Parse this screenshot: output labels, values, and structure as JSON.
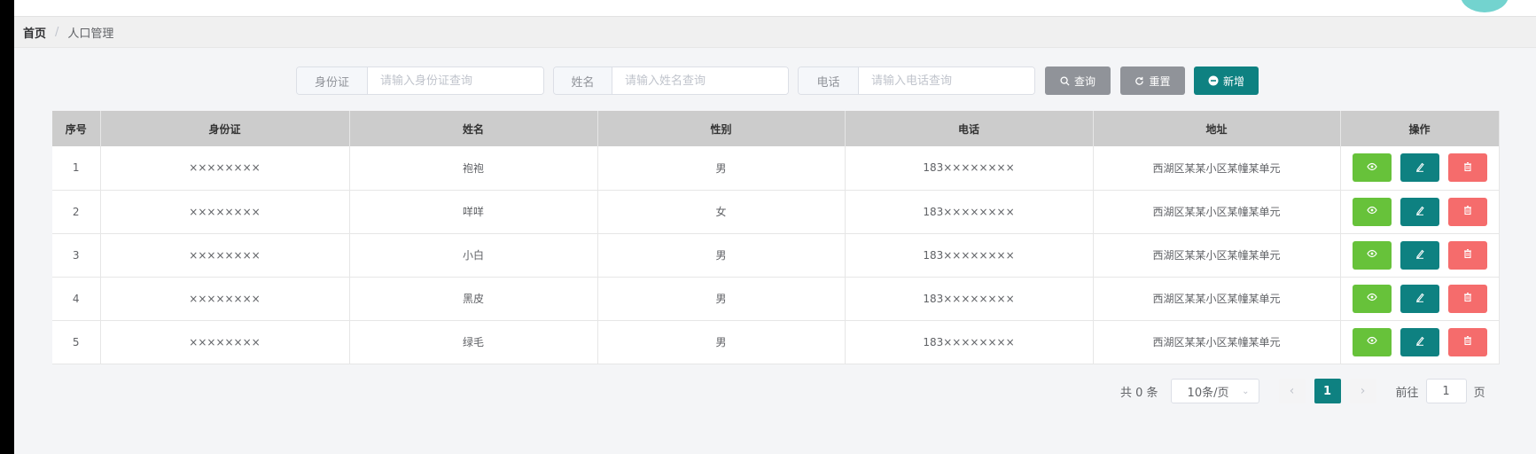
{
  "breadcrumb": {
    "home": "首页",
    "separator": "/",
    "current": "人口管理"
  },
  "search": {
    "id_label": "身份证",
    "id_placeholder": "请输入身份证查询",
    "name_label": "姓名",
    "name_placeholder": "请输入姓名查询",
    "phone_label": "电话",
    "phone_placeholder": "请输入电话查询",
    "query_button": "查询",
    "reset_button": "重置",
    "add_button": "新增"
  },
  "table": {
    "headers": [
      "序号",
      "身份证",
      "姓名",
      "性别",
      "电话",
      "地址",
      "操作"
    ],
    "rows": [
      {
        "no": "1",
        "id": "××××××××",
        "name": "袍袍",
        "gender": "男",
        "phone": "183××××××××",
        "address": "西湖区某某小区某幢某单元"
      },
      {
        "no": "2",
        "id": "××××××××",
        "name": "咩咩",
        "gender": "女",
        "phone": "183××××××××",
        "address": "西湖区某某小区某幢某单元"
      },
      {
        "no": "3",
        "id": "××××××××",
        "name": "小白",
        "gender": "男",
        "phone": "183××××××××",
        "address": "西湖区某某小区某幢某单元"
      },
      {
        "no": "4",
        "id": "××××××××",
        "name": "黑皮",
        "gender": "男",
        "phone": "183××××××××",
        "address": "西湖区某某小区某幢某单元"
      },
      {
        "no": "5",
        "id": "××××××××",
        "name": "绿毛",
        "gender": "男",
        "phone": "183××××××××",
        "address": "西湖区某某小区某幢某单元"
      }
    ]
  },
  "pagination": {
    "total": "共 0 条",
    "page_size": "10条/页",
    "current_page": "1",
    "goto_label": "前往",
    "goto_value": "1",
    "page_suffix": "页"
  },
  "colors": {
    "accent": "#0e8181",
    "view": "#67c23a",
    "delete": "#f56c6c",
    "header_bg": "#cccccc"
  },
  "icons": {
    "query": "search-icon",
    "reset": "refresh-icon",
    "add": "plus-circle-icon",
    "view": "eye-icon",
    "edit": "pencil-icon",
    "delete": "trash-icon"
  }
}
